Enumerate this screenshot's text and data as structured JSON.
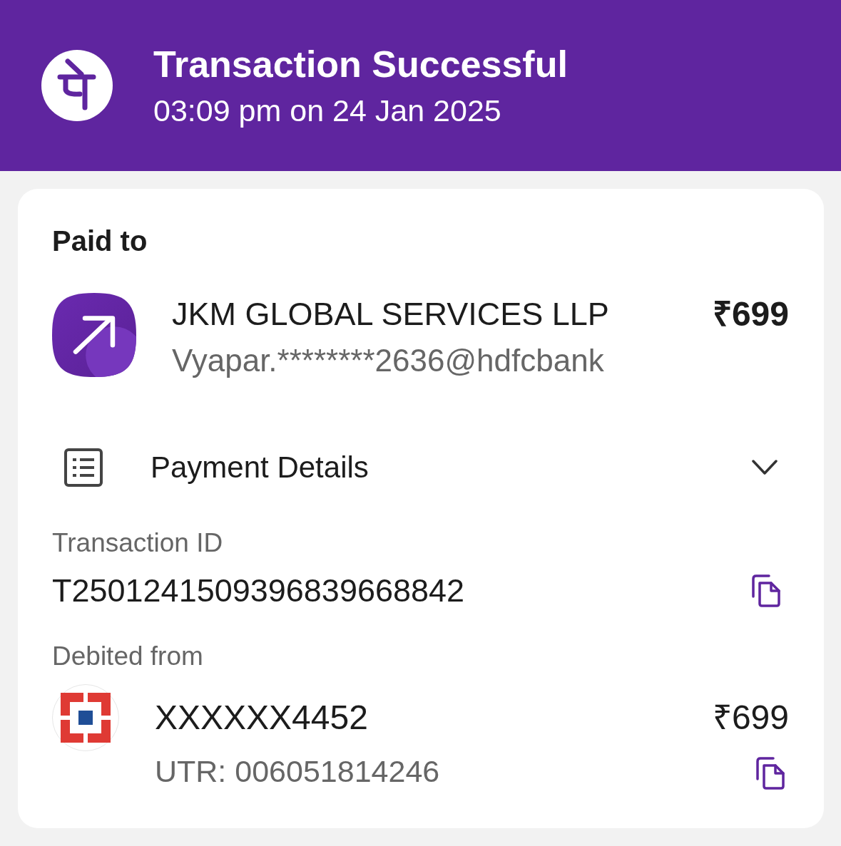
{
  "header": {
    "title": "Transaction Successful",
    "subtitle": "03:09 pm on 24 Jan 2025"
  },
  "paid_to": {
    "label": "Paid to",
    "name": "JKM GLOBAL SERVICES LLP",
    "upi_id": "Vyapar.********2636@hdfcbank",
    "amount": "₹699"
  },
  "payment_details": {
    "title": "Payment Details",
    "transaction_id": {
      "label": "Transaction ID",
      "value": "T2501241509396839668842"
    },
    "debited_from": {
      "label": "Debited from",
      "account": "XXXXXX4452",
      "amount": "₹699",
      "utr": "UTR: 006051814246"
    }
  }
}
